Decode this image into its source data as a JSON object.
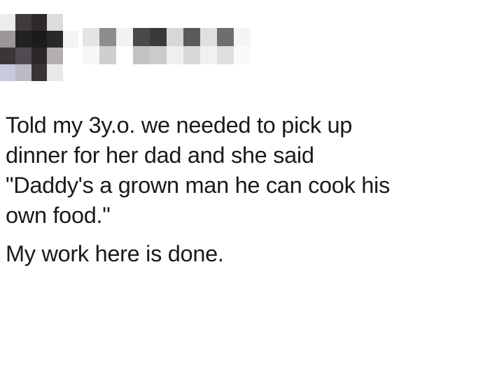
{
  "post": {
    "text_main": "Told my 3y.o. we needed to pick up\ndinner for her dad and she said\n\"Daddy's a grown man he can cook his\nown food.\"",
    "text_followup": "My work here is done."
  },
  "colors": {
    "background": "#ffffff",
    "text": "#1a1a1a"
  }
}
